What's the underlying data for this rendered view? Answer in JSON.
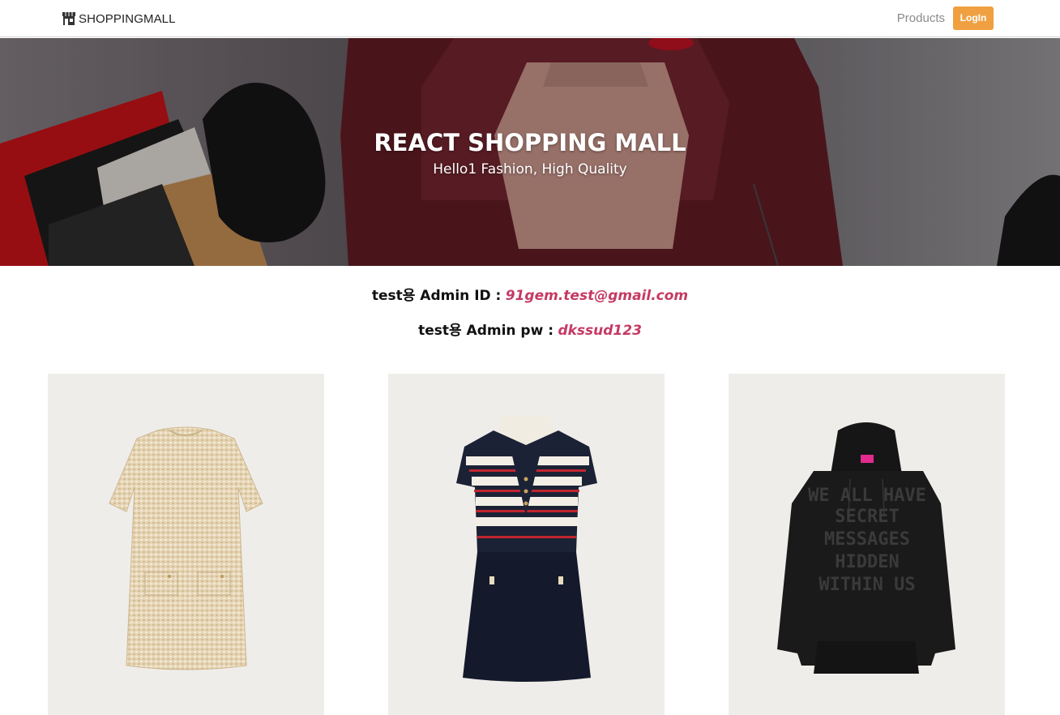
{
  "navbar": {
    "brand": "SHOPPINGMALL",
    "brand_icon": "store-icon",
    "products_link": "Products",
    "login_button": "LogIn"
  },
  "hero": {
    "title": "REACT SHOPPING MALL",
    "subtitle": "Hello1 Fashion, High Quality"
  },
  "credentials": {
    "id_label": "test용 Admin ID :",
    "id_value": "91gem.test@gmail.com",
    "pw_label": "test용 Admin pw :",
    "pw_value": "dkssud123"
  },
  "products": [
    {
      "name": "tweed-dress",
      "icon": "tweed-dress-image"
    },
    {
      "name": "striped-knit-dress",
      "icon": "striped-dress-image"
    },
    {
      "name": "black-hoodie",
      "icon": "hoodie-image",
      "print_text": [
        "WE ALL HAVE",
        "SECRET",
        "MESSAGES",
        "HIDDEN",
        "WITHIN US"
      ]
    }
  ],
  "colors": {
    "accent": "#f0a040",
    "credential_value": "#c53a64",
    "card_bg": "#efedea"
  }
}
